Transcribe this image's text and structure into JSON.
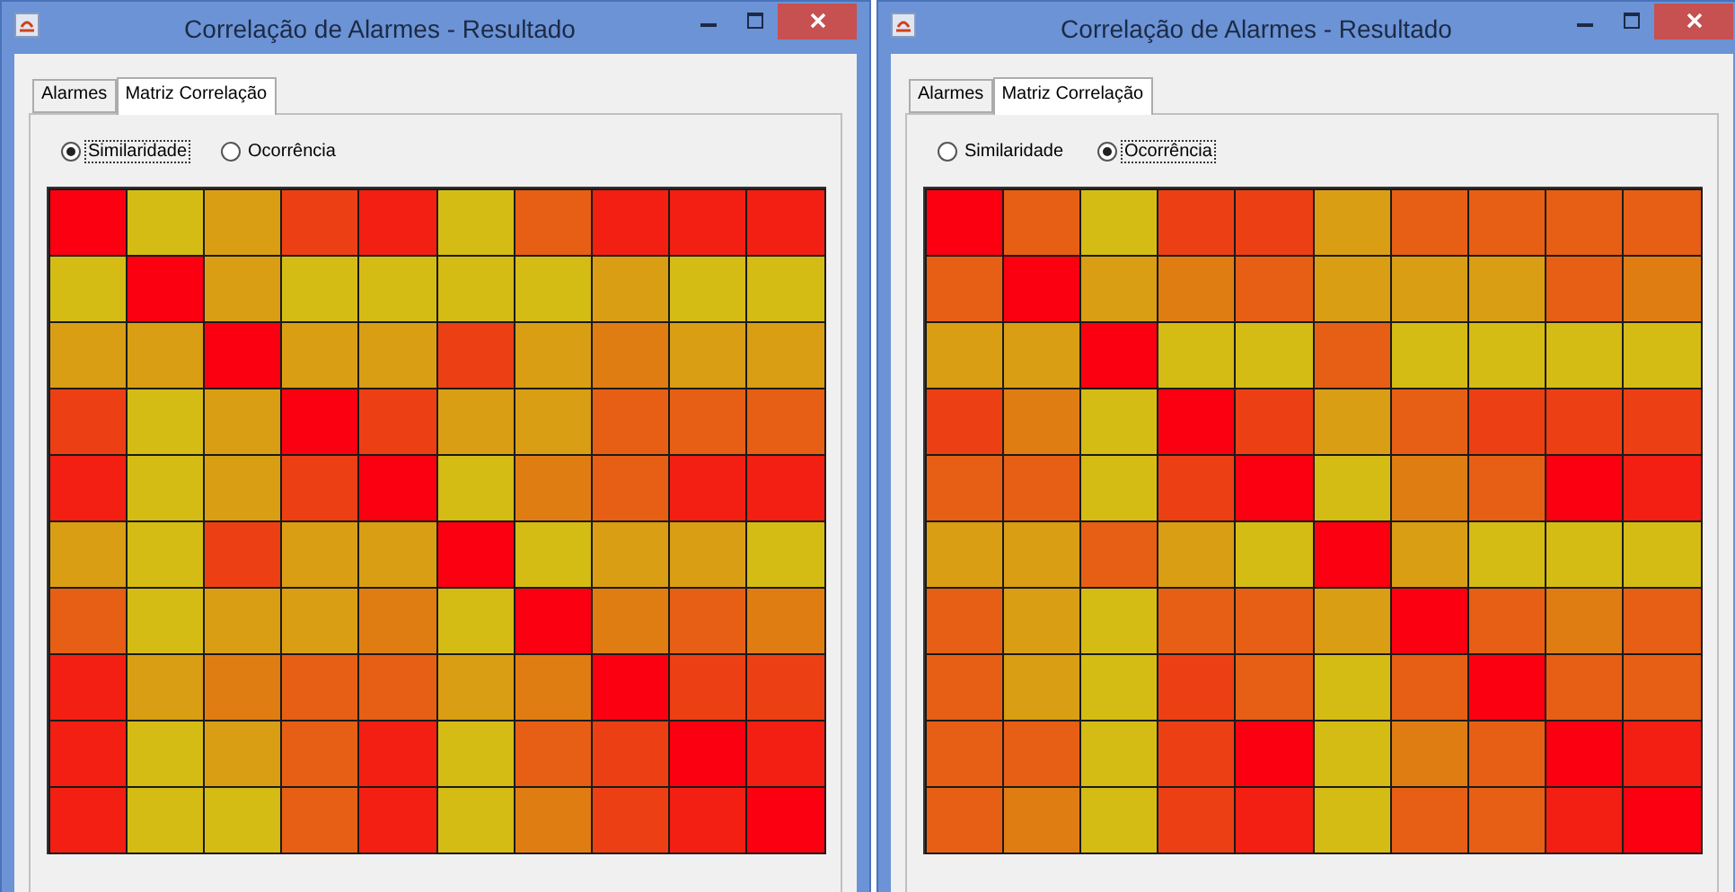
{
  "windows": [
    {
      "title": "Correlação de Alarmes - Resultado",
      "tabs": [
        {
          "label": "Alarmes",
          "selected": false
        },
        {
          "label": "Matriz Correlação",
          "selected": true
        }
      ],
      "options": [
        {
          "label": "Similaridade",
          "selected": true
        },
        {
          "label": "Ocorrência",
          "selected": false
        }
      ],
      "matrix": [
        {
          "cells": [
            {
              "color": "#fa0010"
            },
            {
              "color": "#d4bc15"
            },
            {
              "color": "#d99e14"
            },
            {
              "color": "#ed3f14"
            },
            {
              "color": "#f21f12"
            },
            {
              "color": "#d4bc15"
            },
            {
              "color": "#e65f14"
            },
            {
              "color": "#f21f12"
            },
            {
              "color": "#f21f12"
            },
            {
              "color": "#f21f12"
            }
          ]
        },
        {
          "cells": [
            {
              "color": "#d4bc15"
            },
            {
              "color": "#fa0010"
            },
            {
              "color": "#d99e14"
            },
            {
              "color": "#d4bc15"
            },
            {
              "color": "#d4bc15"
            },
            {
              "color": "#d4bc15"
            },
            {
              "color": "#d4bc15"
            },
            {
              "color": "#d99e14"
            },
            {
              "color": "#d4bc15"
            },
            {
              "color": "#d4bc15"
            }
          ]
        },
        {
          "cells": [
            {
              "color": "#d99e14"
            },
            {
              "color": "#d99e14"
            },
            {
              "color": "#fa0010"
            },
            {
              "color": "#d99e14"
            },
            {
              "color": "#d99e14"
            },
            {
              "color": "#ed3f14"
            },
            {
              "color": "#d99e14"
            },
            {
              "color": "#e07d12"
            },
            {
              "color": "#d99e14"
            },
            {
              "color": "#d99e14"
            }
          ]
        },
        {
          "cells": [
            {
              "color": "#ed3f14"
            },
            {
              "color": "#d4bc15"
            },
            {
              "color": "#d99e14"
            },
            {
              "color": "#fa0010"
            },
            {
              "color": "#ed3f14"
            },
            {
              "color": "#d99e14"
            },
            {
              "color": "#d99e14"
            },
            {
              "color": "#e65f14"
            },
            {
              "color": "#e65f14"
            },
            {
              "color": "#e65f14"
            }
          ]
        },
        {
          "cells": [
            {
              "color": "#f21f12"
            },
            {
              "color": "#d4bc15"
            },
            {
              "color": "#d99e14"
            },
            {
              "color": "#ed3f14"
            },
            {
              "color": "#fa0010"
            },
            {
              "color": "#d4bc15"
            },
            {
              "color": "#e07d12"
            },
            {
              "color": "#e65f14"
            },
            {
              "color": "#f21f12"
            },
            {
              "color": "#f21f12"
            }
          ]
        },
        {
          "cells": [
            {
              "color": "#d99e14"
            },
            {
              "color": "#d4bc15"
            },
            {
              "color": "#ed3f14"
            },
            {
              "color": "#d99e14"
            },
            {
              "color": "#d99e14"
            },
            {
              "color": "#fa0010"
            },
            {
              "color": "#d4bc15"
            },
            {
              "color": "#d99e14"
            },
            {
              "color": "#d99e14"
            },
            {
              "color": "#d4bc15"
            }
          ]
        },
        {
          "cells": [
            {
              "color": "#e65f14"
            },
            {
              "color": "#d4bc15"
            },
            {
              "color": "#d99e14"
            },
            {
              "color": "#d99e14"
            },
            {
              "color": "#e07d12"
            },
            {
              "color": "#d4bc15"
            },
            {
              "color": "#fa0010"
            },
            {
              "color": "#e07d12"
            },
            {
              "color": "#e65f14"
            },
            {
              "color": "#e07d12"
            }
          ]
        },
        {
          "cells": [
            {
              "color": "#f21f12"
            },
            {
              "color": "#d99e14"
            },
            {
              "color": "#e07d12"
            },
            {
              "color": "#e65f14"
            },
            {
              "color": "#e65f14"
            },
            {
              "color": "#d99e14"
            },
            {
              "color": "#e07d12"
            },
            {
              "color": "#fa0010"
            },
            {
              "color": "#ed3f14"
            },
            {
              "color": "#ed3f14"
            }
          ]
        },
        {
          "cells": [
            {
              "color": "#f21f12"
            },
            {
              "color": "#d4bc15"
            },
            {
              "color": "#d99e14"
            },
            {
              "color": "#e65f14"
            },
            {
              "color": "#f21f12"
            },
            {
              "color": "#d4bc15"
            },
            {
              "color": "#e65f14"
            },
            {
              "color": "#ed3f14"
            },
            {
              "color": "#fa0010"
            },
            {
              "color": "#f21f12"
            }
          ]
        },
        {
          "cells": [
            {
              "color": "#f21f12"
            },
            {
              "color": "#d4bc15"
            },
            {
              "color": "#d4bc15"
            },
            {
              "color": "#e65f14"
            },
            {
              "color": "#f21f12"
            },
            {
              "color": "#d4bc15"
            },
            {
              "color": "#e07d12"
            },
            {
              "color": "#ed3f14"
            },
            {
              "color": "#f21f12"
            },
            {
              "color": "#fa0010"
            }
          ]
        }
      ]
    },
    {
      "title": "Correlação de Alarmes - Resultado",
      "tabs": [
        {
          "label": "Alarmes",
          "selected": false
        },
        {
          "label": "Matriz Correlação",
          "selected": true
        }
      ],
      "options": [
        {
          "label": "Similaridade",
          "selected": false
        },
        {
          "label": "Ocorrência",
          "selected": true
        }
      ],
      "matrix": [
        {
          "cells": [
            {
              "color": "#fa0010"
            },
            {
              "color": "#e65f14"
            },
            {
              "color": "#d4bc15"
            },
            {
              "color": "#ed3f14"
            },
            {
              "color": "#ed3f14"
            },
            {
              "color": "#d99e14"
            },
            {
              "color": "#e65f14"
            },
            {
              "color": "#e65f14"
            },
            {
              "color": "#e65f14"
            },
            {
              "color": "#e65f14"
            }
          ]
        },
        {
          "cells": [
            {
              "color": "#e65f14"
            },
            {
              "color": "#fa0010"
            },
            {
              "color": "#d99e14"
            },
            {
              "color": "#e07d12"
            },
            {
              "color": "#e65f14"
            },
            {
              "color": "#d99e14"
            },
            {
              "color": "#d99e14"
            },
            {
              "color": "#d99e14"
            },
            {
              "color": "#e65f14"
            },
            {
              "color": "#e07d12"
            }
          ]
        },
        {
          "cells": [
            {
              "color": "#d99e14"
            },
            {
              "color": "#d99e14"
            },
            {
              "color": "#fa0010"
            },
            {
              "color": "#d4bc15"
            },
            {
              "color": "#d4bc15"
            },
            {
              "color": "#e65f14"
            },
            {
              "color": "#d4bc15"
            },
            {
              "color": "#d4bc15"
            },
            {
              "color": "#d4bc15"
            },
            {
              "color": "#d4bc15"
            }
          ]
        },
        {
          "cells": [
            {
              "color": "#ed3f14"
            },
            {
              "color": "#e07d12"
            },
            {
              "color": "#d4bc15"
            },
            {
              "color": "#fa0010"
            },
            {
              "color": "#ed3f14"
            },
            {
              "color": "#d99e14"
            },
            {
              "color": "#e65f14"
            },
            {
              "color": "#ed3f14"
            },
            {
              "color": "#ed3f14"
            },
            {
              "color": "#ed3f14"
            }
          ]
        },
        {
          "cells": [
            {
              "color": "#e65f14"
            },
            {
              "color": "#e65f14"
            },
            {
              "color": "#d4bc15"
            },
            {
              "color": "#ed3f14"
            },
            {
              "color": "#fa0010"
            },
            {
              "color": "#d4bc15"
            },
            {
              "color": "#e07d12"
            },
            {
              "color": "#e65f14"
            },
            {
              "color": "#fa0010"
            },
            {
              "color": "#f21f12"
            }
          ]
        },
        {
          "cells": [
            {
              "color": "#d99e14"
            },
            {
              "color": "#d99e14"
            },
            {
              "color": "#e65f14"
            },
            {
              "color": "#d99e14"
            },
            {
              "color": "#d4bc15"
            },
            {
              "color": "#fa0010"
            },
            {
              "color": "#d99e14"
            },
            {
              "color": "#d4bc15"
            },
            {
              "color": "#d4bc15"
            },
            {
              "color": "#d4bc15"
            }
          ]
        },
        {
          "cells": [
            {
              "color": "#e65f14"
            },
            {
              "color": "#d99e14"
            },
            {
              "color": "#d4bc15"
            },
            {
              "color": "#e65f14"
            },
            {
              "color": "#e65f14"
            },
            {
              "color": "#d99e14"
            },
            {
              "color": "#fa0010"
            },
            {
              "color": "#e65f14"
            },
            {
              "color": "#e07d12"
            },
            {
              "color": "#e65f14"
            }
          ]
        },
        {
          "cells": [
            {
              "color": "#e65f14"
            },
            {
              "color": "#d99e14"
            },
            {
              "color": "#d4bc15"
            },
            {
              "color": "#ed3f14"
            },
            {
              "color": "#e65f14"
            },
            {
              "color": "#d4bc15"
            },
            {
              "color": "#e65f14"
            },
            {
              "color": "#fa0010"
            },
            {
              "color": "#e65f14"
            },
            {
              "color": "#e65f14"
            }
          ]
        },
        {
          "cells": [
            {
              "color": "#e65f14"
            },
            {
              "color": "#e65f14"
            },
            {
              "color": "#d4bc15"
            },
            {
              "color": "#ed3f14"
            },
            {
              "color": "#fa0010"
            },
            {
              "color": "#d4bc15"
            },
            {
              "color": "#e07d12"
            },
            {
              "color": "#e65f14"
            },
            {
              "color": "#fa0010"
            },
            {
              "color": "#f21f12"
            }
          ]
        },
        {
          "cells": [
            {
              "color": "#e65f14"
            },
            {
              "color": "#e07d12"
            },
            {
              "color": "#d4bc15"
            },
            {
              "color": "#ed3f14"
            },
            {
              "color": "#f21f12"
            },
            {
              "color": "#d4bc15"
            },
            {
              "color": "#e65f14"
            },
            {
              "color": "#e65f14"
            },
            {
              "color": "#f21f12"
            },
            {
              "color": "#fa0010"
            }
          ]
        }
      ]
    }
  ]
}
